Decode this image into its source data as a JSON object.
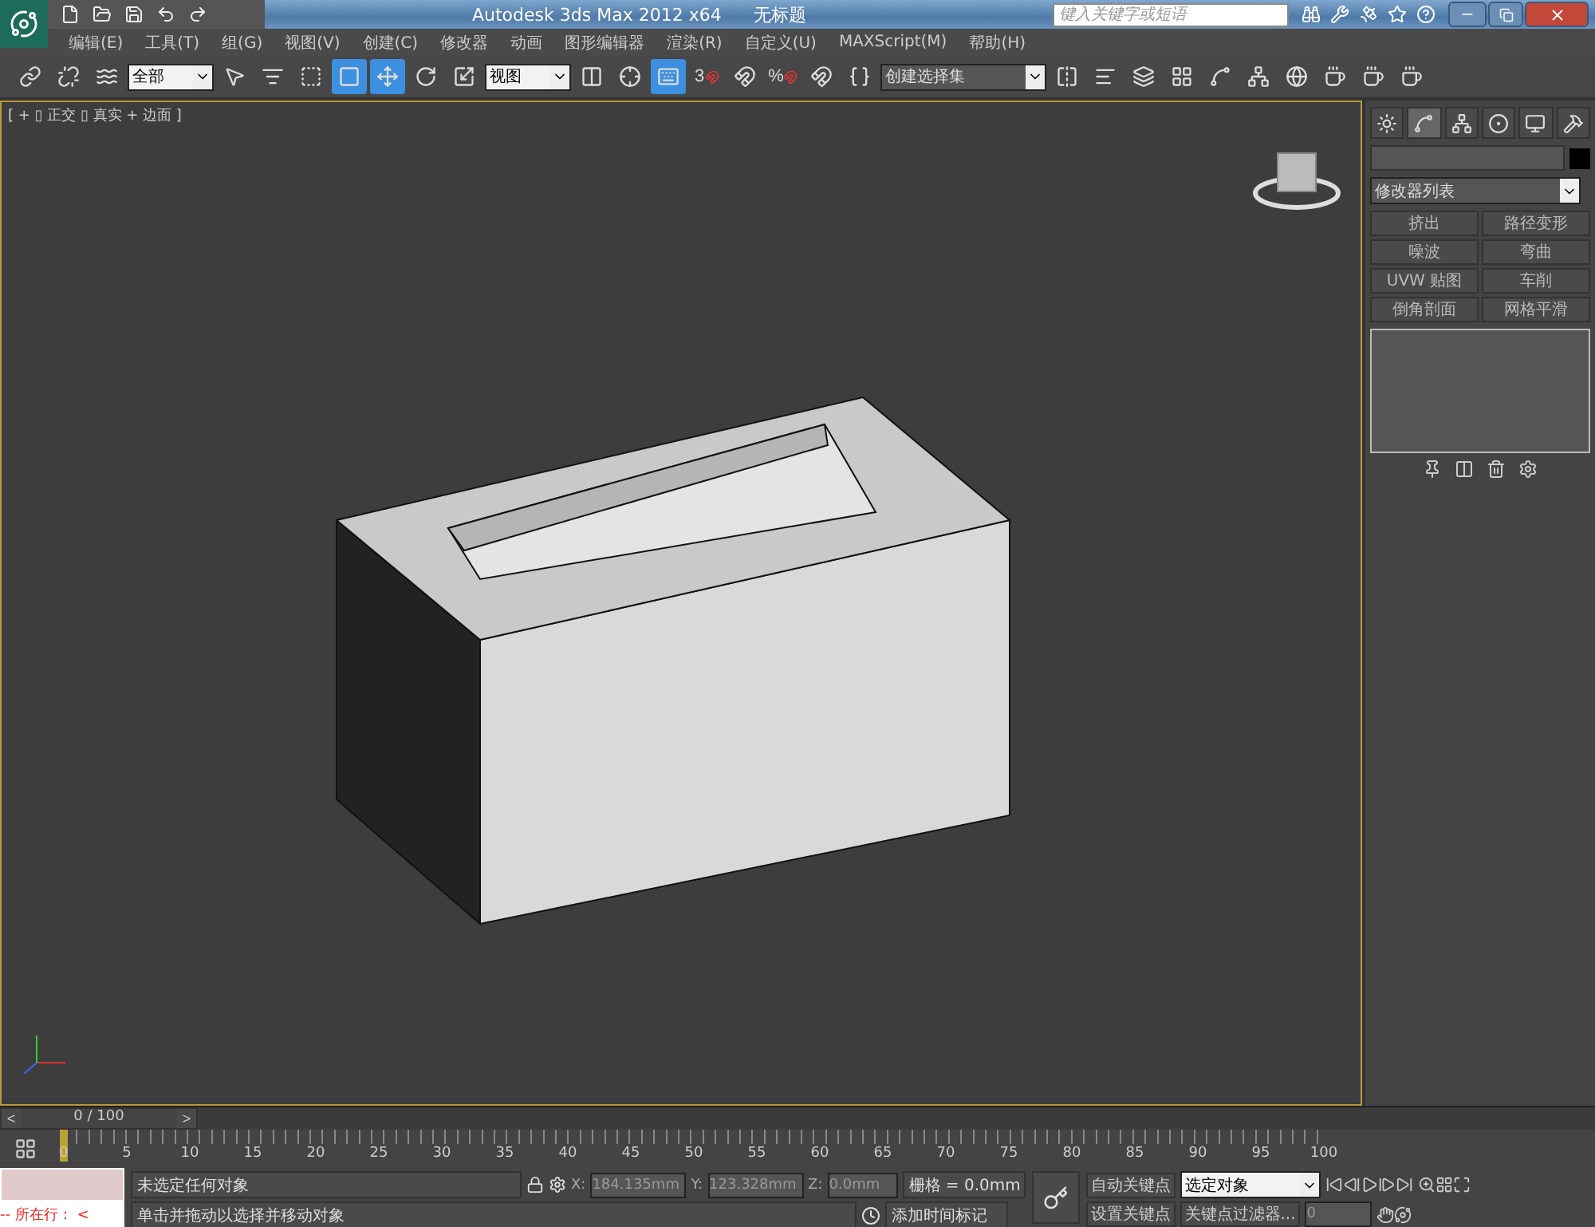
{
  "window": {
    "app_title": "Autodesk 3ds Max  2012 x64",
    "document_title": "无标题"
  },
  "search": {
    "placeholder": "键入关键字或短语"
  },
  "menu": [
    "编辑(E)",
    "工具(T)",
    "组(G)",
    "视图(V)",
    "创建(C)",
    "修改器",
    "动画",
    "图形编辑器",
    "渲染(R)",
    "自定义(U)",
    "MAXScript(M)",
    "帮助(H)"
  ],
  "toolbar": [
    {
      "kind": "link",
      "selected": false
    },
    {
      "kind": "unlink",
      "selected": false
    },
    {
      "kind": "bind",
      "selected": false
    },
    {
      "kind": "dropdown",
      "value": "全部"
    },
    {
      "kind": "select",
      "selected": false
    },
    {
      "kind": "select_by_name",
      "selected": false
    },
    {
      "kind": "region",
      "selected": false
    },
    {
      "kind": "window",
      "selected": true
    },
    {
      "kind": "move",
      "selected": true
    },
    {
      "kind": "rotate",
      "selected": false
    },
    {
      "kind": "scale",
      "selected": false
    },
    {
      "kind": "dropdown",
      "value": "视图"
    },
    {
      "kind": "pivot",
      "selected": false
    },
    {
      "kind": "manipulate",
      "selected": false
    },
    {
      "kind": "keyboard",
      "selected": true
    },
    {
      "kind": "snap",
      "label": "3",
      "selected": false
    },
    {
      "kind": "angle_snap",
      "selected": false
    },
    {
      "kind": "snap",
      "label": "%",
      "selected": false
    },
    {
      "kind": "spinner_snap",
      "selected": false
    },
    {
      "kind": "edit_sets",
      "selected": false
    },
    {
      "kind": "dropdown",
      "value": "创建选择集"
    },
    {
      "kind": "mirror",
      "selected": false
    },
    {
      "kind": "align",
      "selected": false
    },
    {
      "kind": "layers",
      "selected": false
    },
    {
      "kind": "graphite",
      "selected": false
    },
    {
      "kind": "curve",
      "selected": false
    },
    {
      "kind": "schematic",
      "selected": false
    },
    {
      "kind": "material",
      "selected": false
    },
    {
      "kind": "render_setup",
      "selected": false
    },
    {
      "kind": "render_frame",
      "selected": false
    },
    {
      "kind": "render",
      "selected": false
    }
  ],
  "viewport": {
    "label": "[ + ▯ 正交 ▯ 真实 + 边面 ]"
  },
  "command_panel": {
    "tabs": [
      {
        "kind": "create",
        "selected": false
      },
      {
        "kind": "modify",
        "selected": true
      },
      {
        "kind": "hierarchy",
        "selected": false
      },
      {
        "kind": "motion",
        "selected": false
      },
      {
        "kind": "display",
        "selected": false
      },
      {
        "kind": "utilities",
        "selected": false
      }
    ],
    "modifier_list": "修改器列表",
    "modifiers": [
      "挤出",
      "路径变形",
      "噪波",
      "弯曲",
      "UVW 贴图",
      "车削",
      "倒角剖面",
      "网格平滑"
    ]
  },
  "timeline": {
    "prev": "<",
    "position": "0 / 100",
    "next": ">",
    "level": 0,
    "ticks": [
      "0",
      "5",
      "10",
      "15",
      "20",
      "25",
      "30",
      "35",
      "40",
      "45",
      "50",
      "55",
      "60",
      "65",
      "70",
      "75",
      "80",
      "85",
      "90",
      "95",
      "100"
    ]
  },
  "status": {
    "listener_text": "--  所在行：  <",
    "selection": "未选定任何对象",
    "prompt": "单击并拖动以选择并移动对象",
    "x_label": "X:",
    "x": "184.135mm",
    "y_label": "Y:",
    "y": "123.328mm",
    "z_label": "Z:",
    "z": "0.0mm",
    "grid": "栅格 = 0.0mm",
    "add_time_tag": "添加时间标记",
    "auto_key": "自动关键点",
    "set_key": "设置关键点",
    "key_mode": "选定对象",
    "key_filters": "关键点过滤器...",
    "frame": "0"
  }
}
